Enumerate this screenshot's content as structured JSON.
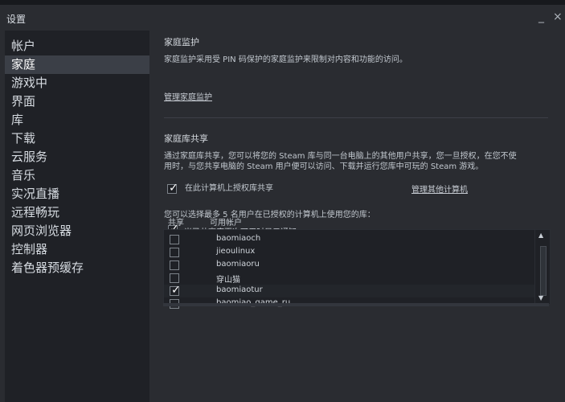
{
  "window": {
    "title": "设置",
    "minimize_label": "_",
    "close_label": "×"
  },
  "sidebar": {
    "items": [
      {
        "label": "帐户"
      },
      {
        "label": "家庭"
      },
      {
        "label": "游戏中"
      },
      {
        "label": "界面"
      },
      {
        "label": "库"
      },
      {
        "label": "下载"
      },
      {
        "label": "云服务"
      },
      {
        "label": "音乐"
      },
      {
        "label": "实况直播"
      },
      {
        "label": "远程畅玩"
      },
      {
        "label": "网页浏览器"
      },
      {
        "label": "控制器"
      },
      {
        "label": "着色器预缓存"
      }
    ],
    "active_index": 1
  },
  "main": {
    "family_view": {
      "title": "家庭监护",
      "description": "家庭监护采用受 PIN 码保护的家庭监护来限制对内容和功能的访问。",
      "manage_link": "管理家庭监护"
    },
    "library_sharing": {
      "title": "家庭库共享",
      "description_line1": "通过家庭库共享，您可以将您的 Steam 库与同一台电脑上的其他用户共享，您一旦授权，在您不使",
      "description_line2": "用时，与您共享电脑的 Steam 用户便可以访问、下载并运行您库中可玩的 Steam 游戏。",
      "authorize_label": "在此计算机上授权库共享",
      "authorize_checked": true,
      "manage_other_link": "管理其他计算机",
      "select_users_text": "您可以选择最多 5 名用户在已授权的计算机上使用您的库：",
      "table": {
        "col_share": "共享",
        "col_account": "可用帐户",
        "notification_label": "当已共享库再次可用时显示通知",
        "notification_checked": true,
        "rows": [
          {
            "name": "baomiaoch",
            "checked": false
          },
          {
            "name": "jieoulinux",
            "checked": false
          },
          {
            "name": "baomiaoru",
            "checked": false
          },
          {
            "name": "穿山猫",
            "checked": false
          },
          {
            "name": "baomiaotur",
            "checked": true
          },
          {
            "name": "baomiao_game_ru",
            "checked": false
          }
        ],
        "scroll_up": "▲",
        "scroll_down": "▼"
      }
    }
  }
}
